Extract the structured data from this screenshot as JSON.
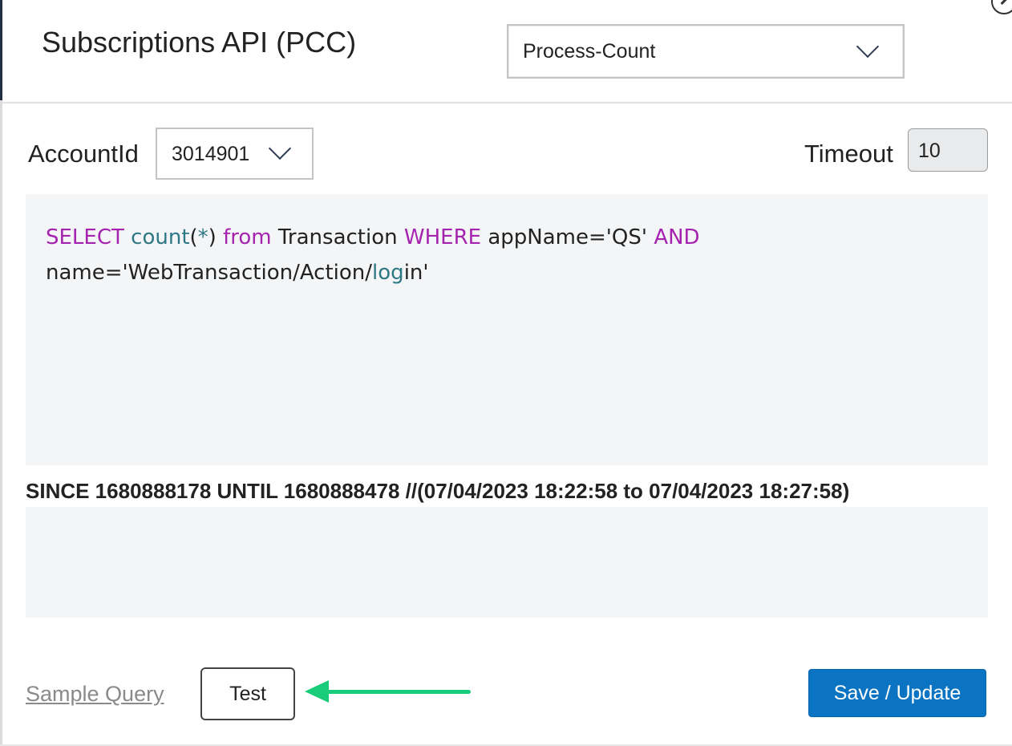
{
  "header": {
    "title": "Subscriptions API (PCC)",
    "process_select": {
      "value": "Process-Count"
    }
  },
  "form": {
    "account_label": "AccountId",
    "account_value": "3014901",
    "timeout_label": "Timeout",
    "timeout_value": "10"
  },
  "query": {
    "line1": [
      {
        "text": "SELECT",
        "kind": "keyword"
      },
      {
        "text": " ",
        "kind": "plain"
      },
      {
        "text": "count",
        "kind": "function"
      },
      {
        "text": "(",
        "kind": "plain"
      },
      {
        "text": "*",
        "kind": "function"
      },
      {
        "text": ") ",
        "kind": "plain"
      },
      {
        "text": "from",
        "kind": "keyword"
      },
      {
        "text": " Transaction ",
        "kind": "plain"
      },
      {
        "text": "WHERE",
        "kind": "keyword"
      },
      {
        "text": " appName='QS' ",
        "kind": "plain"
      },
      {
        "text": "AND",
        "kind": "keyword"
      }
    ],
    "line2": [
      {
        "text": "name='WebTransaction/Action/",
        "kind": "plain"
      },
      {
        "text": "log",
        "kind": "function"
      },
      {
        "text": "in'",
        "kind": "plain"
      }
    ]
  },
  "since_text": "SINCE 1680888178 UNTIL 1680888478 //(07/04/2023 18:22:58 to 07/04/2023 18:27:58)",
  "footer": {
    "sample_link": "Sample Query",
    "test_label": "Test",
    "save_label": "Save / Update"
  },
  "colors": {
    "keyword": "#a424b0",
    "function": "#2e7886",
    "primary_button": "#0b74c2",
    "annotation_arrow": "#19cc7a"
  },
  "icons": {
    "close": "close-icon",
    "dropdown": "chevron-down-icon",
    "annotation": "arrow-left-icon"
  }
}
